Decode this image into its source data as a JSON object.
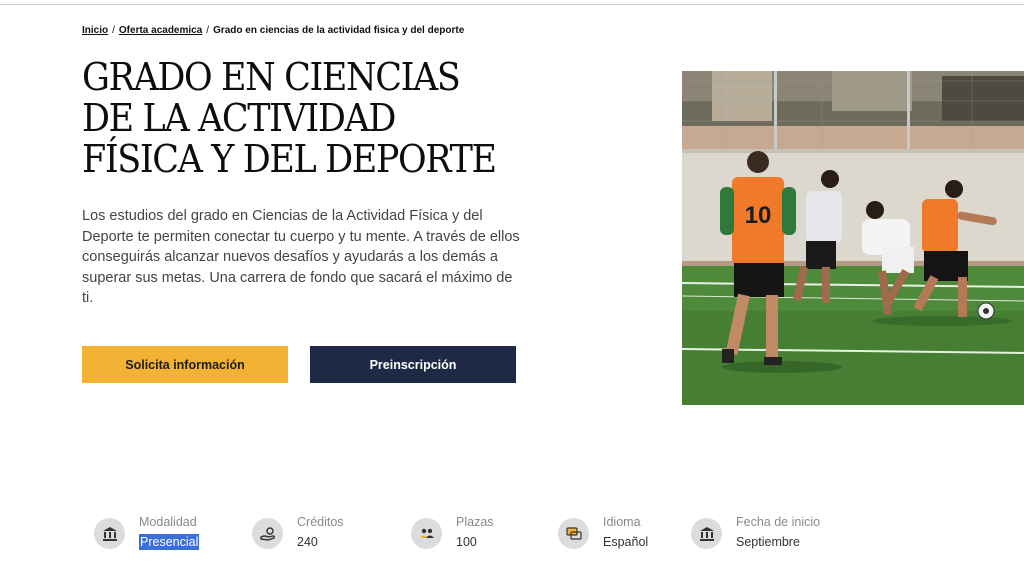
{
  "breadcrumb": {
    "items": [
      {
        "label": "Inicio"
      },
      {
        "label": "Oferta academica"
      }
    ],
    "separator": "/",
    "current": "Grado en ciencias de la actividad fisica y del deporte"
  },
  "hero": {
    "title": "GRADO EN CIENCIAS DE LA ACTIVIDAD FÍSICA Y DEL DEPORTE",
    "description": "Los estudios del grado en Ciencias de la Actividad Física y del Deporte te permiten conectar tu cuerpo y tu mente. A través de ellos conseguirás alcanzar nuevos desafíos y ayudarás a los demás a superar sus metas. Una carrera de fondo que sacará el máximo de ti."
  },
  "buttons": {
    "info_label": "Solicita información",
    "pre_label": "Preinscripción"
  },
  "photo": {
    "jersey_number": "10"
  },
  "facts": [
    {
      "label": "Modalidad",
      "value": "Presencial",
      "icon": "building-icon"
    },
    {
      "label": "Créditos",
      "value": "240",
      "icon": "hand-coins-icon"
    },
    {
      "label": "Plazas",
      "value": "100",
      "icon": "group-icon"
    },
    {
      "label": "Idioma",
      "value": "Español",
      "icon": "chat-icon"
    },
    {
      "label": "Fecha de inicio",
      "value": "Septiembre",
      "icon": "building-icon"
    }
  ],
  "colors": {
    "accent_yellow": "#f3b233",
    "navy": "#1e2a45",
    "selection": "#3a6fd8"
  }
}
